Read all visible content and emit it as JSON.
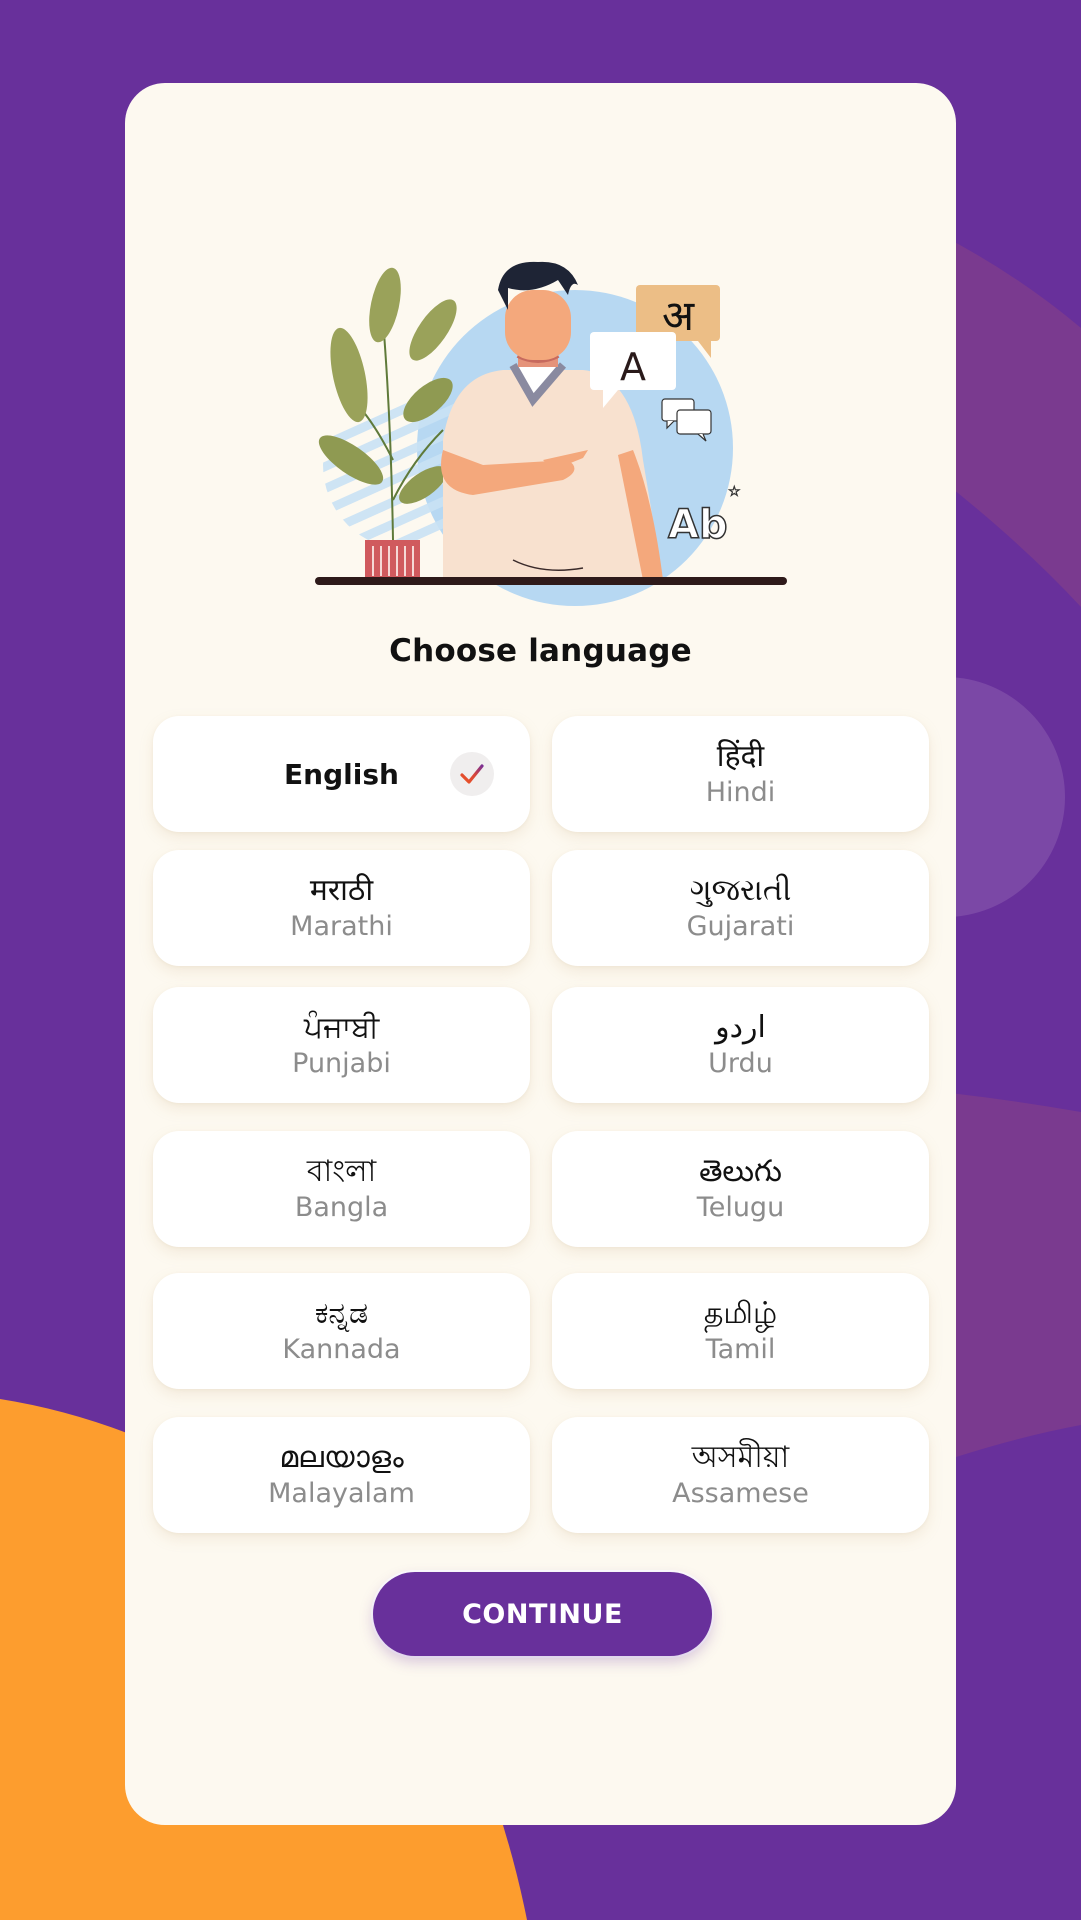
{
  "colors": {
    "background": "#68309b",
    "accent_band": "#7a3a8f",
    "accent_circle": "#7b48a6",
    "accent_orange": "#fd9d2e",
    "card": "#fdf9f0",
    "button": "#68309b"
  },
  "header": {
    "title": "Choose language"
  },
  "illustration": {
    "bubble_hindi_glyph": "अ",
    "bubble_latin_glyph": "A",
    "label_ab": "Ab"
  },
  "languages": [
    {
      "native": "English",
      "english": "English",
      "selected": true
    },
    {
      "native": "हिंदी",
      "english": "Hindi",
      "selected": false
    },
    {
      "native": "मराठी",
      "english": "Marathi",
      "selected": false
    },
    {
      "native": "ગુજરાતી",
      "english": "Gujarati",
      "selected": false
    },
    {
      "native": "ਪੰਜਾਬੀ",
      "english": "Punjabi",
      "selected": false
    },
    {
      "native": "اردو",
      "english": "Urdu",
      "selected": false
    },
    {
      "native": "বাংলা",
      "english": "Bangla",
      "selected": false
    },
    {
      "native": "తెలుగు",
      "english": "Telugu",
      "selected": false
    },
    {
      "native": "ಕನ್ನಡ",
      "english": "Kannada",
      "selected": false
    },
    {
      "native": "தமிழ்",
      "english": "Tamil",
      "selected": false
    },
    {
      "native": "മലയാളം",
      "english": "Malayalam",
      "selected": false
    },
    {
      "native": "অসমীয়া",
      "english": "Assamese",
      "selected": false
    }
  ],
  "selected_icon": "check-icon",
  "footer": {
    "continue_label": "CONTINUE"
  }
}
